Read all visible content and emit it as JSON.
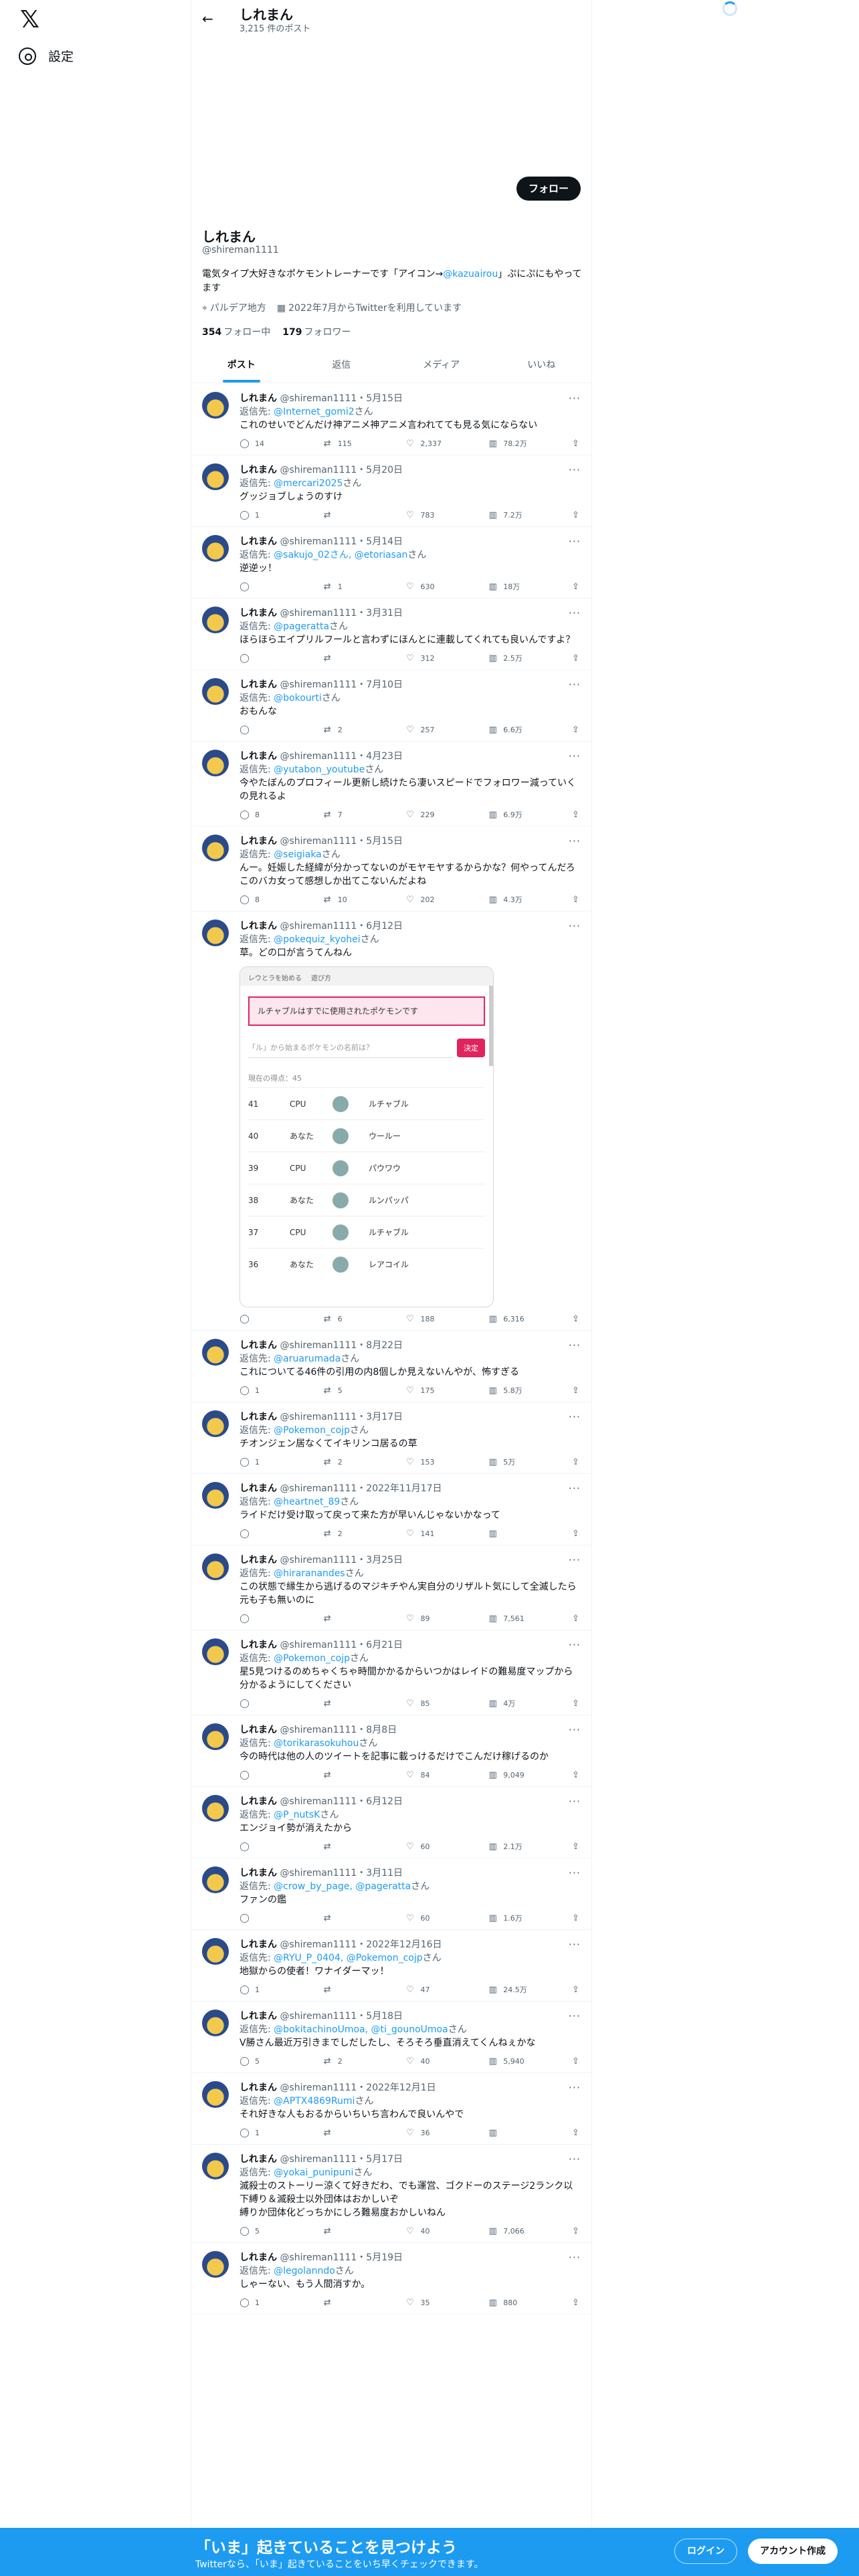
{
  "nav": {
    "logo": "𝕏",
    "settings_label": "設定"
  },
  "header": {
    "name": "しれまん",
    "post_count": "3,215 件のポスト"
  },
  "profile": {
    "follow_label": "フォロー",
    "name": "しれまん",
    "handle": "@shireman1111",
    "bio_before": "電気タイプ大好きなポケモントレーナーです「アイコン→",
    "bio_link": "@kazuairou",
    "bio_after": "」ぷにぷにもやってます",
    "location": "パルデア地方",
    "joined": "2022年7月からTwitterを利用しています",
    "following_count": "354",
    "following_label": "フォロー中",
    "followers_count": "179",
    "followers_label": "フォロワー"
  },
  "tabs": [
    "ポスト",
    "返信",
    "メディア",
    "いいね"
  ],
  "tweets": [
    {
      "name": "しれまん",
      "meta": "@shireman1111・5月15日",
      "to": "@Internet_gomi2",
      "text": "これのせいでどんだけ神アニメ神アニメ言われてても見る気にならない",
      "reply": "14",
      "rt": "115",
      "like": "2,337",
      "views": "78.2万"
    },
    {
      "name": "しれまん",
      "meta": "@shireman1111・5月20日",
      "to": "@mercari2025",
      "text": "グッジョブしょうのすけ",
      "reply": "1",
      "rt": "",
      "like": "783",
      "views": "7.2万"
    },
    {
      "name": "しれまん",
      "meta": "@shireman1111・5月14日",
      "to": "@sakujo_02さん, @etoriasan",
      "text": "逆逆ッ！",
      "reply": "",
      "rt": "1",
      "like": "630",
      "views": "18万"
    },
    {
      "name": "しれまん",
      "meta": "@shireman1111・3月31日",
      "to": "@pageratta",
      "text": "ほらほらエイプリルフールと言わずにほんとに連載してくれても良いんですよ？",
      "reply": "",
      "rt": "",
      "like": "312",
      "views": "2.5万"
    },
    {
      "name": "しれまん",
      "meta": "@shireman1111・7月10日",
      "to": "@bokourti",
      "text": "おもんな",
      "reply": "",
      "rt": "2",
      "like": "257",
      "views": "6.6万"
    },
    {
      "name": "しれまん",
      "meta": "@shireman1111・4月23日",
      "to": "@yutabon_youtube",
      "text": "今やたぼんのプロフィール更新し続けたら凄いスピードでフォロワー減っていくの見れるよ",
      "reply": "8",
      "rt": "7",
      "like": "229",
      "views": "6.9万"
    },
    {
      "name": "しれまん",
      "meta": "@shireman1111・5月15日",
      "to": "@seigiaka",
      "text": "んー。妊娠した経緯が分かってないのがモヤモヤするからかな？何やってんだろこのバカ女って感想しか出てこないんだよね",
      "reply": "8",
      "rt": "10",
      "like": "202",
      "views": "4.3万"
    },
    {
      "name": "しれまん",
      "meta": "@shireman1111・6月12日",
      "to": "@pokequiz_kyohei",
      "text": "草。どの口が言うてんねん",
      "reply": "",
      "rt": "6",
      "like": "188",
      "views": "6,316",
      "embed": true
    },
    {
      "name": "しれまん",
      "meta": "@shireman1111・8月22日",
      "to": "@aruarumada",
      "text": "これについてる46件の引用の内8個しか見えないんやが、怖すぎる",
      "reply": "1",
      "rt": "5",
      "like": "175",
      "views": "5.8万"
    },
    {
      "name": "しれまん",
      "meta": "@shireman1111・3月17日",
      "to": "@Pokemon_cojp",
      "text": "チオンジェン居なくてイキリンコ居るの草",
      "reply": "1",
      "rt": "2",
      "like": "153",
      "views": "5万"
    },
    {
      "name": "しれまん",
      "meta": "@shireman1111・2022年11月17日",
      "to": "@heartnet_89",
      "text": "ライドだけ受け取って戻って来た方が早いんじゃないかなって",
      "reply": "",
      "rt": "2",
      "like": "141",
      "views": ""
    },
    {
      "name": "しれまん",
      "meta": "@shireman1111・3月25日",
      "to": "@hiraranandes",
      "text": "この状態で縁生から逃げるのマジキチやん実自分のリザルト気にして全滅したら元も子も無いのに",
      "reply": "",
      "rt": "",
      "like": "89",
      "views": "7,561"
    },
    {
      "name": "しれまん",
      "meta": "@shireman1111・6月21日",
      "to": "@Pokemon_cojp",
      "text": "星5見つけるのめちゃくちゃ時間かかるからいつかはレイドの難易度マップから分かるようにしてください",
      "reply": "",
      "rt": "",
      "like": "85",
      "views": "4万"
    },
    {
      "name": "しれまん",
      "meta": "@shireman1111・8月8日",
      "to": "@torikarasokuhou",
      "text": "今の時代は他の人のツイートを記事に載っけるだけでこんだけ稼げるのか",
      "reply": "",
      "rt": "",
      "like": "84",
      "views": "9,049"
    },
    {
      "name": "しれまん",
      "meta": "@shireman1111・6月12日",
      "to": "@P_nutsK",
      "text": "エンジョイ勢が消えたから",
      "reply": "",
      "rt": "",
      "like": "60",
      "views": "2.1万"
    },
    {
      "name": "しれまん",
      "meta": "@shireman1111・3月11日",
      "to": "@crow_by_page, @pageratta",
      "text": "ファンの鑑",
      "reply": "",
      "rt": "",
      "like": "60",
      "views": "1.6万"
    },
    {
      "name": "しれまん",
      "meta": "@shireman1111・2022年12月16日",
      "to": "@RYU_P_0404, @Pokemon_cojp",
      "text": "地獄からの使者！ワナイダーマッ！",
      "reply": "1",
      "rt": "",
      "like": "47",
      "views": "24.5万"
    },
    {
      "name": "しれまん",
      "meta": "@shireman1111・5月18日",
      "to": "@bokitachinoUmoa, @ti_gounoUmoa",
      "text": "V勝さん最近万引きまでしだしたし、そろそろ垂直消えてくんねぇかな",
      "reply": "5",
      "rt": "2",
      "like": "40",
      "views": "5,940"
    },
    {
      "name": "しれまん",
      "meta": "@shireman1111・2022年12月1日",
      "to": "@APTX4869Rumi",
      "text": "それ好きな人もおるからいちいち言わんで良いんやで",
      "reply": "1",
      "rt": "",
      "like": "36",
      "views": ""
    },
    {
      "name": "しれまん",
      "meta": "@shireman1111・5月17日",
      "to": "@yokai_punipuni",
      "text": "滅殺士のストーリー涼くて好きだわ、でも運営、ゴクドーのステージ2ランク以下縛り＆滅殺士以外団体はおかしいぞ\n縛りか団体化どっちかにしろ難易度おかしいねん",
      "reply": "5",
      "rt": "",
      "like": "40",
      "views": "7,066"
    },
    {
      "name": "しれまん",
      "meta": "@shireman1111・5月19日",
      "to": "@legolanndo",
      "text": "しゃーない、もう人間消すか。",
      "reply": "1",
      "rt": "",
      "like": "35",
      "views": "880"
    }
  ],
  "labels": {
    "reply_to": "返信先: ",
    "san": "さん"
  },
  "embed": {
    "tab1": "レウとラを始める",
    "tab2": "遊び方",
    "alert": "ルチャブルはすでに使用されたポケモンです",
    "placeholder": "「ル」から始まるポケモンの名前は？",
    "submit": "決定",
    "count": "現在の得点：45",
    "rows": [
      {
        "n": "41",
        "who": "CPU",
        "poke": "ルチャブル"
      },
      {
        "n": "40",
        "who": "あなた",
        "poke": "ウールー"
      },
      {
        "n": "39",
        "who": "CPU",
        "poke": "パウワウ"
      },
      {
        "n": "38",
        "who": "あなた",
        "poke": "ルンパッパ"
      },
      {
        "n": "37",
        "who": "CPU",
        "poke": "ルチャブル"
      },
      {
        "n": "36",
        "who": "あなた",
        "poke": "レアコイル"
      }
    ]
  },
  "bottom": {
    "title": "「いま」起きていることを見つけよう",
    "subtitle": "Twitterなら、「いま」起きていることをいち早くチェックできます。",
    "login": "ログイン",
    "signup": "アカウント作成"
  }
}
